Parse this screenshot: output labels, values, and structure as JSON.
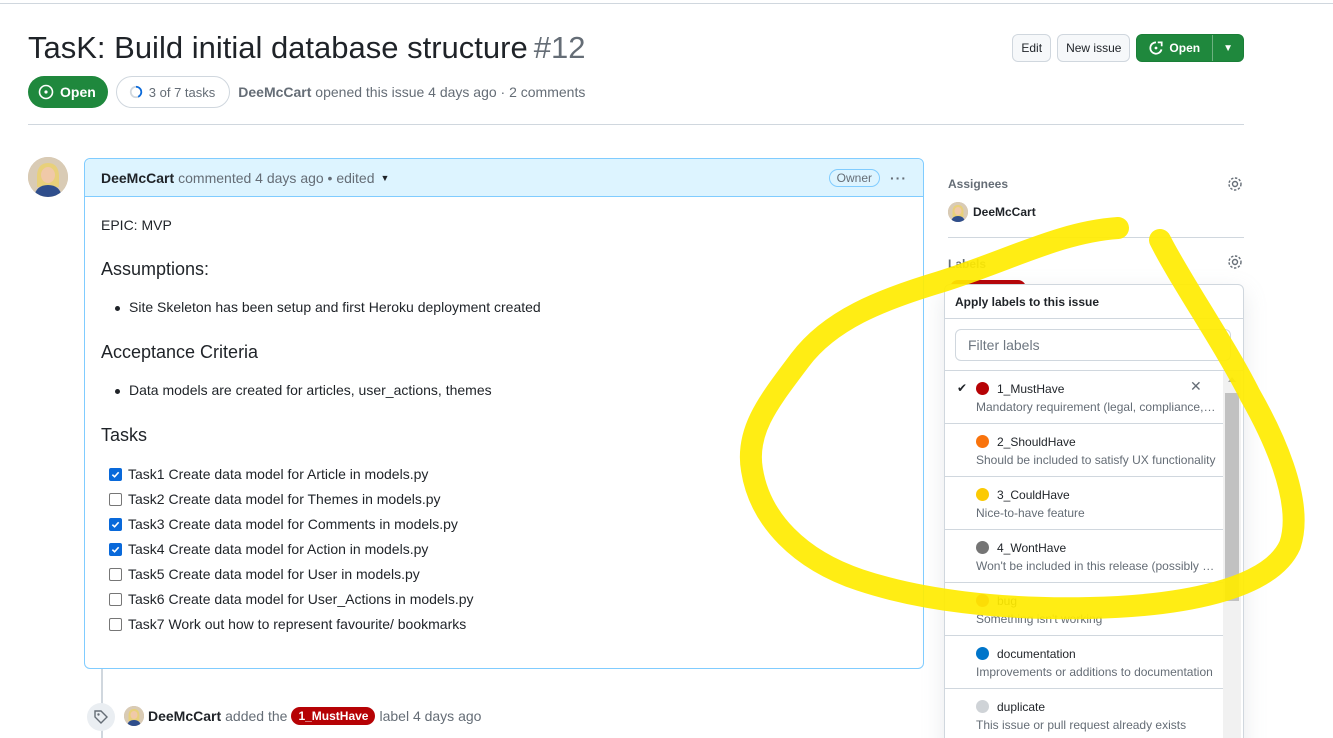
{
  "issue": {
    "title": "TasK: Build initial database structure",
    "number": "#12",
    "state": "Open",
    "tasks_progress": "3 of 7 tasks",
    "author": "DeeMcCart",
    "meta_text": "opened this issue 4 days ago · 2 comments"
  },
  "header_actions": {
    "edit_label": "Edit",
    "new_issue_label": "New issue",
    "open_label": "Open"
  },
  "comment": {
    "author": "DeeMcCart",
    "meta": "commented 4 days ago • edited",
    "owner_badge": "Owner",
    "epic": "EPIC: MVP",
    "assumptions_heading": "Assumptions:",
    "assumptions": [
      "Site Skeleton has been setup and first Heroku deployment created"
    ],
    "acceptance_heading": "Acceptance Criteria",
    "acceptance": [
      "Data models are created for articles, user_actions, themes"
    ],
    "tasks_heading": "Tasks",
    "tasks": [
      {
        "text": "Task1 Create data model for Article in models.py",
        "checked": true
      },
      {
        "text": "Task2 Create data model for Themes in models.py",
        "checked": false
      },
      {
        "text": "Task3 Create data model for Comments in models.py",
        "checked": true
      },
      {
        "text": "Task4 Create data model for Action in models.py",
        "checked": true
      },
      {
        "text": "Task5 Create data model for User in models.py",
        "checked": false
      },
      {
        "text": "Task6 Create data model for User_Actions in models.py",
        "checked": false
      },
      {
        "text": "Task7 Work out how to represent favourite/ bookmarks",
        "checked": false
      }
    ]
  },
  "timeline": {
    "actor": "DeeMcCart",
    "action": "added the",
    "label": "1_MustHave",
    "suffix": "label 4 days ago"
  },
  "sidebar": {
    "assignees_heading": "Assignees",
    "assignee": "DeeMcCart",
    "labels_heading": "Labels"
  },
  "label_menu": {
    "title": "Apply labels to this issue",
    "filter_placeholder": "Filter labels",
    "items": [
      {
        "name": "1_MustHave",
        "desc": "Mandatory requirement (legal, compliance, or critical)",
        "color": "#b60205",
        "selected": true
      },
      {
        "name": "2_ShouldHave",
        "desc": "Should be included to satisfy UX functionality",
        "color": "#f9730c",
        "selected": false
      },
      {
        "name": "3_CouldHave",
        "desc": "Nice-to-have feature",
        "color": "#fbca04",
        "selected": false
      },
      {
        "name": "4_WontHave",
        "desc": "Won't be included in this release (possibly later)",
        "color": "#757575",
        "selected": false
      },
      {
        "name": "bug",
        "desc": "Something isn't working",
        "color": "#d73a4a",
        "selected": false
      },
      {
        "name": "documentation",
        "desc": "Improvements or additions to documentation",
        "color": "#0075ca",
        "selected": false
      },
      {
        "name": "duplicate",
        "desc": "This issue or pull request already exists",
        "color": "#cfd3d7",
        "selected": false
      }
    ]
  },
  "colors": {
    "accent_green": "#1f883d",
    "highlight_yellow": "#ffeb00",
    "link_blue": "#0969da"
  }
}
